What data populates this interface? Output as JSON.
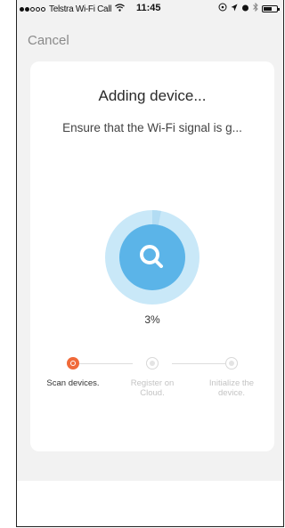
{
  "status_bar": {
    "carrier": "Telstra Wi-Fi Call",
    "time": "11:45"
  },
  "nav": {
    "cancel_label": "Cancel"
  },
  "card": {
    "title": "Adding device...",
    "subtitle": "Ensure that the Wi-Fi signal is g...",
    "progress_text": "3%",
    "progress_value": 3
  },
  "steps": [
    {
      "label": "Scan devices.",
      "state": "active"
    },
    {
      "label": "Register on Cloud.",
      "state": "pending"
    },
    {
      "label": "Initialize the device.",
      "state": "pending"
    }
  ],
  "colors": {
    "accent": "#f06a3a",
    "progress_ring": "#bfe3f7",
    "progress_center": "#5bb4e8"
  }
}
